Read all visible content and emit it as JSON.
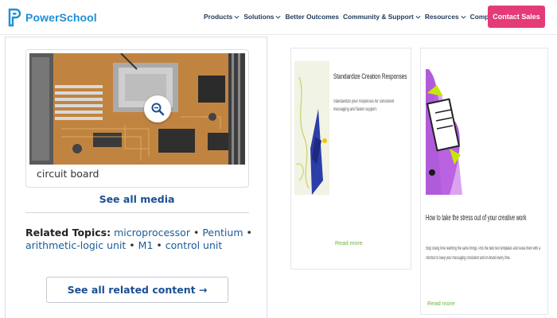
{
  "header": {
    "brand": "PowerSchool",
    "nav": [
      {
        "label": "Products"
      },
      {
        "label": "Solutions"
      },
      {
        "label": "Better Outcomes"
      },
      {
        "label": "Community & Support"
      },
      {
        "label": "Resources"
      },
      {
        "label": "Company"
      }
    ],
    "cta_label": "Contact Sales",
    "colors": {
      "brand": "#1f8fd6",
      "cta": "#e43b78",
      "nav_text": "#1e3a5a"
    }
  },
  "media": {
    "caption": "circuit board",
    "see_all_label": "See all media",
    "zoom_icon": "magnifier-icon",
    "image_subject": "circuit-board-photo"
  },
  "related": {
    "label": "Related Topics:",
    "topics": [
      "microprocessor",
      "Pentium",
      "arithmetic-logic unit",
      "M1",
      "control unit"
    ],
    "see_all_label": "See all related content →"
  },
  "ads": [
    {
      "headline": "Standardize Creation Responses",
      "body": "Standardize your responses for consistent messaging and faster support.",
      "link_label": "Read more"
    },
    {
      "headline": "How to take the stress out of your creative work",
      "body": "Stop losing time rewriting the same things. Pick the best text templates and reuse them with a shortcut to keep your messaging consistent and on-brand every time.",
      "link_label": "Read more"
    }
  ]
}
